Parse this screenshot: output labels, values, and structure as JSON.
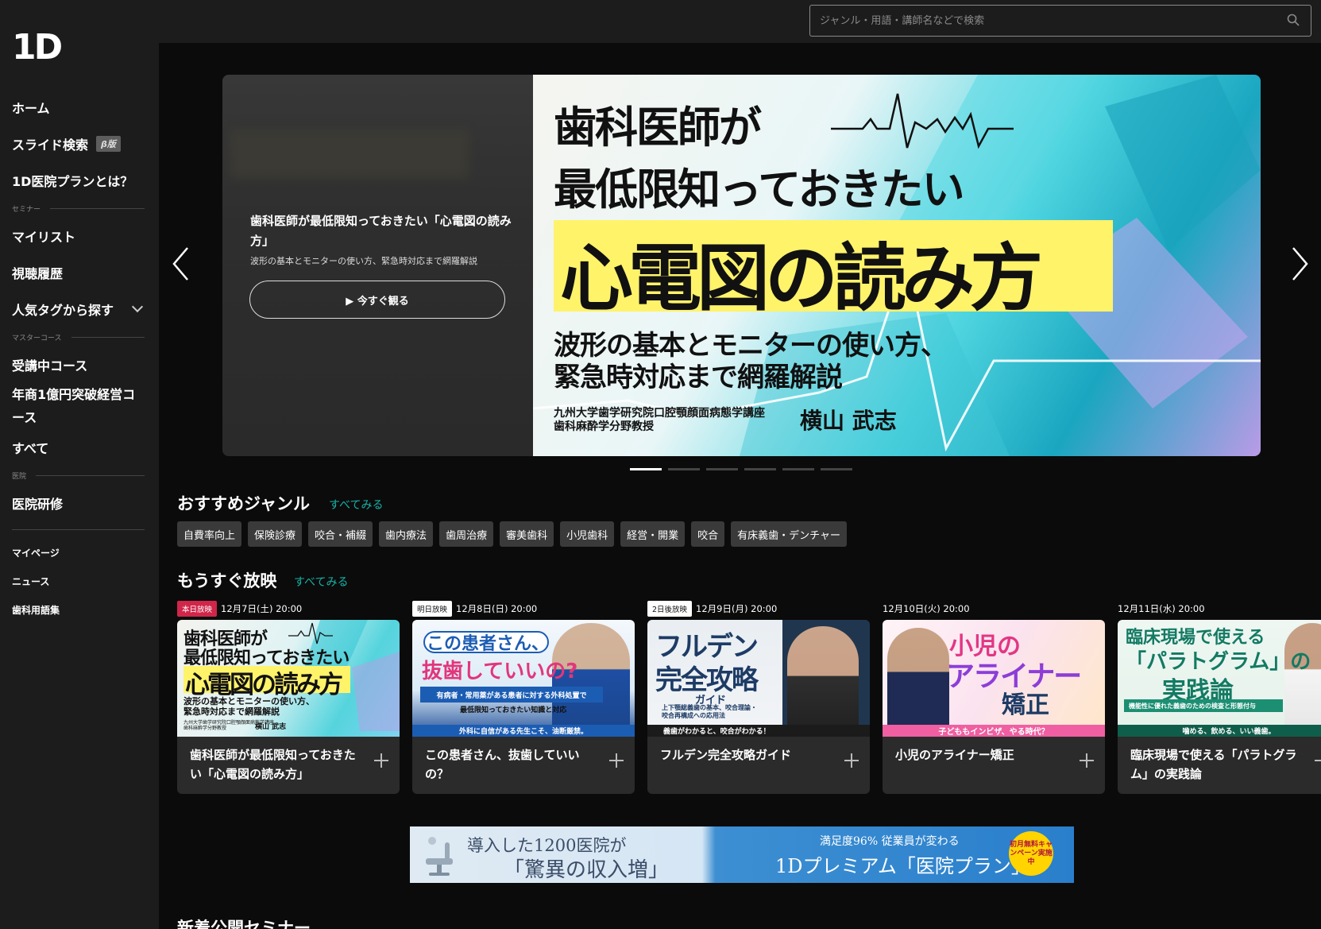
{
  "app": {
    "logo": "1D"
  },
  "search": {
    "placeholder": "ジャンル・用語・講師名などで検索"
  },
  "sidebar": {
    "items_top": [
      {
        "label": "ホーム"
      },
      {
        "label": "スライド検索",
        "badge": "β版"
      },
      {
        "label": "1D医院プランとは？"
      }
    ],
    "section_seminar": "セミナー",
    "items_seminar": [
      {
        "label": "マイリスト"
      },
      {
        "label": "視聴履歴"
      },
      {
        "label": "人気タグから探す"
      }
    ],
    "section_master": "マスターコース",
    "items_master": [
      {
        "label": "受講中コース"
      },
      {
        "label": "年商1億円突破経営コース"
      },
      {
        "label": "すべて"
      }
    ],
    "section_clinic": "医院",
    "items_clinic": [
      {
        "label": "医院研修"
      }
    ],
    "items_bottom": [
      {
        "label": "マイページ"
      },
      {
        "label": "ニュース"
      },
      {
        "label": "歯科用語集"
      }
    ]
  },
  "hero": {
    "title": "歯科医師が最低限知っておきたい「心電図の読み方」",
    "description": "波形の基本とモニターの使い方、緊急時対応まで網羅解説",
    "watch_button": "▶ 今すぐ観る",
    "art": {
      "line1": "歯科医師が",
      "line2": "最低限知っておきたい",
      "line3": "心電図の読み方",
      "line4": "波形の基本とモニターの使い方、",
      "line5": "緊急時対応まで網羅解説",
      "affiliation1": "九州大学歯学研究院口腔顎顔面病態学講座",
      "affiliation2": "歯科麻酔学分野教授",
      "instructor": "横山 武志"
    },
    "slide_count": 6,
    "active_slide": 1
  },
  "genres": {
    "title": "おすすめジャンル",
    "see_all": "すべてみる",
    "chips": [
      "自費率向上",
      "保険診療",
      "咬合・補綴",
      "歯内療法",
      "歯周治療",
      "審美歯科",
      "小児歯科",
      "経営・開業",
      "咬合",
      "有床義歯・デンチャー"
    ]
  },
  "upcoming": {
    "title": "もうすぐ放映",
    "see_all": "すべてみる",
    "cards": [
      {
        "badge": "本日放映",
        "date": "12月7日(土) 20:00",
        "title": "歯科医師が最低限知っておきたい「心電図の読み方」",
        "thumb": {
          "l1": "歯科医師が",
          "l2": "最低限知っておきたい",
          "l3": "心電図の読み方",
          "l4": "波形の基本とモニターの使い方、",
          "l4b": "緊急時対応まで網羅解説",
          "l5": "九州大学歯学研究院口腔顎顔面病態学講座",
          "l5b": "歯科麻酔学分野教授",
          "name": "横山 武志"
        }
      },
      {
        "badge": "明日放映",
        "date": "12月8日(日) 20:00",
        "title": "この患者さん、抜歯していいの？",
        "thumb": {
          "b1": "この患者さん、",
          "b2": "抜歯していいの?",
          "band": "有病者・常用薬がある患者に対する外科処置で",
          "band2": "最低限知っておきたい知識と対応",
          "footer": "外科に自信がある先生こそ、油断厳禁。"
        }
      },
      {
        "badge": "2日後放映",
        "date": "12月9日(月) 20:00",
        "title": "フルデン完全攻略ガイド",
        "thumb": {
          "f1": "フルデン",
          "f2": "完全攻略",
          "gd": "ガイド",
          "f3": "上下顎総義歯の基本、咬合理論・",
          "f3b": "咬合再構成への応用法",
          "f4": "義歯がわかると、咬合がわかる！"
        }
      },
      {
        "badge": "",
        "date": "12月10日(火) 20:00",
        "title": "小児のアライナー矯正",
        "thumb": {
          "p1": "小児の",
          "p2": "アライナー",
          "p3": "矯正",
          "foot": "子どももインビザ、やる時代？"
        }
      },
      {
        "badge": "",
        "date": "12月11日(水) 20:00",
        "title": "臨床現場で使える「パラトグラム」の実践論",
        "thumb": {
          "q1": "臨床現場で使える",
          "q2": "「パラトグラム」の",
          "q3": "実践論",
          "band": "機能性に優れた義歯のための検査と形態付与",
          "foot": "噛める、飲める、いい義歯。"
        }
      }
    ]
  },
  "banner": {
    "left1": "導入した1200医院が",
    "left2": "「驚異の収入増」",
    "right1": "満足度96% 従業員が変わる",
    "right2": "1Dプレミアム「医院プラン」",
    "seal": "初月無料キャンペーン実施中"
  },
  "new_section": {
    "title": "新着公開セミナー"
  }
}
